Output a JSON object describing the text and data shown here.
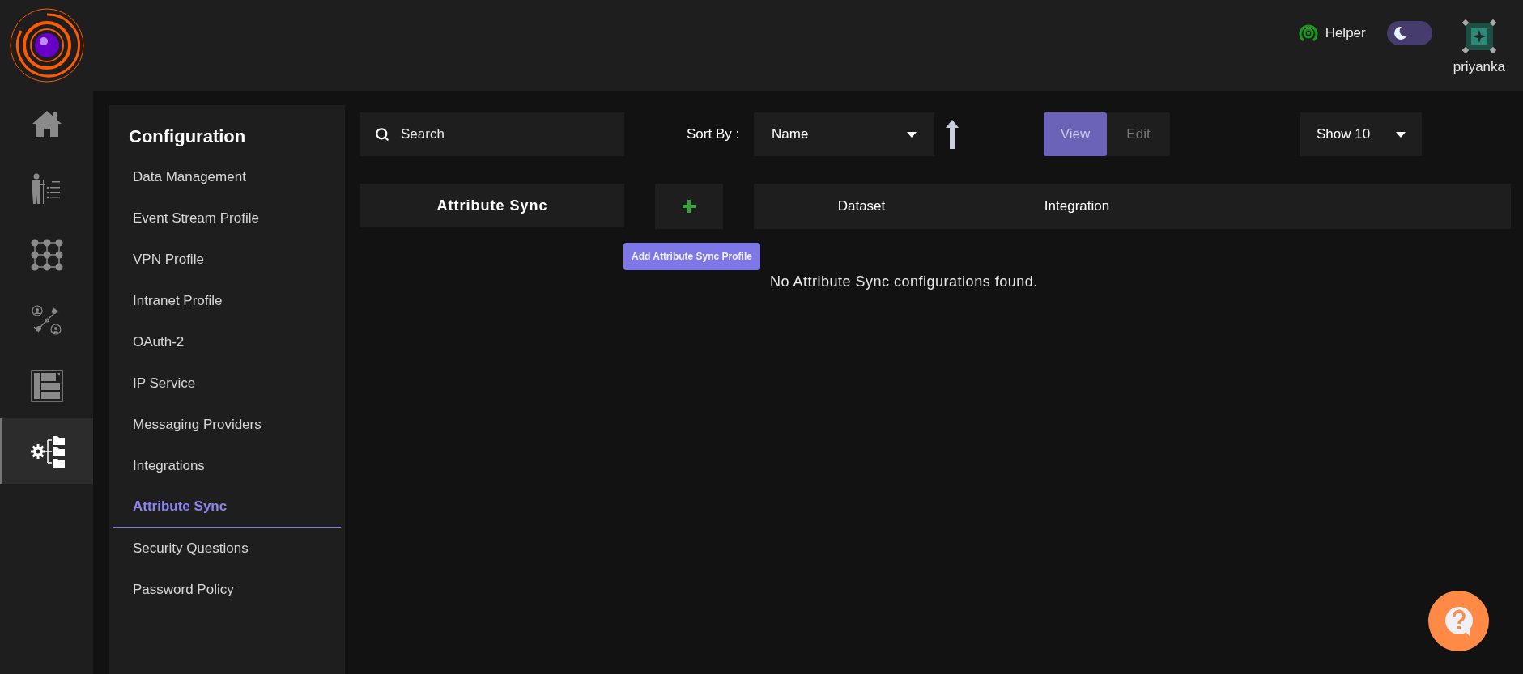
{
  "rail": {
    "items": [
      {
        "kind": "home",
        "selected": false
      },
      {
        "kind": "presenter",
        "selected": false
      },
      {
        "kind": "grid",
        "selected": false
      },
      {
        "kind": "network",
        "selected": false
      },
      {
        "kind": "layout",
        "selected": false
      },
      {
        "kind": "config",
        "selected": true
      }
    ]
  },
  "header": {
    "helper": "Helper",
    "light_mode": false,
    "user": "priyanka"
  },
  "config": {
    "title": "Configuration",
    "items": [
      {
        "label": "Data Management",
        "selected": false
      },
      {
        "label": "Event Stream Profile",
        "selected": false
      },
      {
        "label": "VPN Profile",
        "selected": false
      },
      {
        "label": "Intranet Profile",
        "selected": false
      },
      {
        "label": "OAuth-2",
        "selected": false
      },
      {
        "label": "IP Service",
        "selected": false
      },
      {
        "label": "Messaging Providers",
        "selected": false
      },
      {
        "label": "Integrations",
        "selected": false
      },
      {
        "label": "Attribute Sync",
        "selected": true
      },
      {
        "label": "Security Questions",
        "selected": false
      },
      {
        "label": "Password Policy",
        "selected": false
      }
    ]
  },
  "toolbar": {
    "search_placeholder": "Search",
    "sort_label": "Sort By :",
    "sort_value": "Name",
    "modes": [
      {
        "label": "View",
        "selected": true
      },
      {
        "label": "Edit",
        "selected": false
      }
    ],
    "show": "Show 10"
  },
  "list": {
    "title": "Attribute Sync",
    "add_tooltip": "Add Attribute Sync Profile",
    "columns": [
      "Dataset",
      "Integration"
    ],
    "empty": "No Attribute Sync configurations found."
  }
}
